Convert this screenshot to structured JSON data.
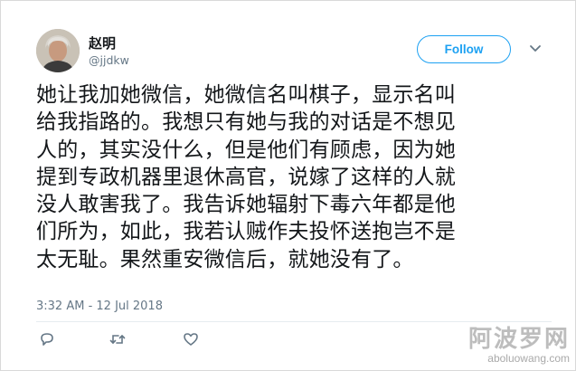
{
  "user": {
    "name": "赵明",
    "handle": "@jjdkw"
  },
  "follow_label": "Follow",
  "tweet": {
    "text": "她让我加她微信，她微信名叫棋子，显示名叫\n给我指路的。我想只有她与我的对话是不想见\n人的，其实没什么，但是他们有顾虑，因为她\n提到专政机器里退休高官，说嫁了这样的人就\n没人敢害我了。我告诉她辐射下毒六年都是他\n们所为，如此，我若认贼作夫投怀送抱岂不是\n太无耻。果然重安微信后，就她没有了。",
    "timestamp": "3:32 AM - 12 Jul 2018"
  },
  "actions": {
    "reply_icon": "reply-icon",
    "retweet_icon": "retweet-icon",
    "like_icon": "heart-icon"
  },
  "watermark": {
    "title": "阿波罗网",
    "url": "aboluowang.com"
  },
  "colors": {
    "accent": "#1da1f2",
    "text": "#14171a",
    "muted": "#657786"
  }
}
